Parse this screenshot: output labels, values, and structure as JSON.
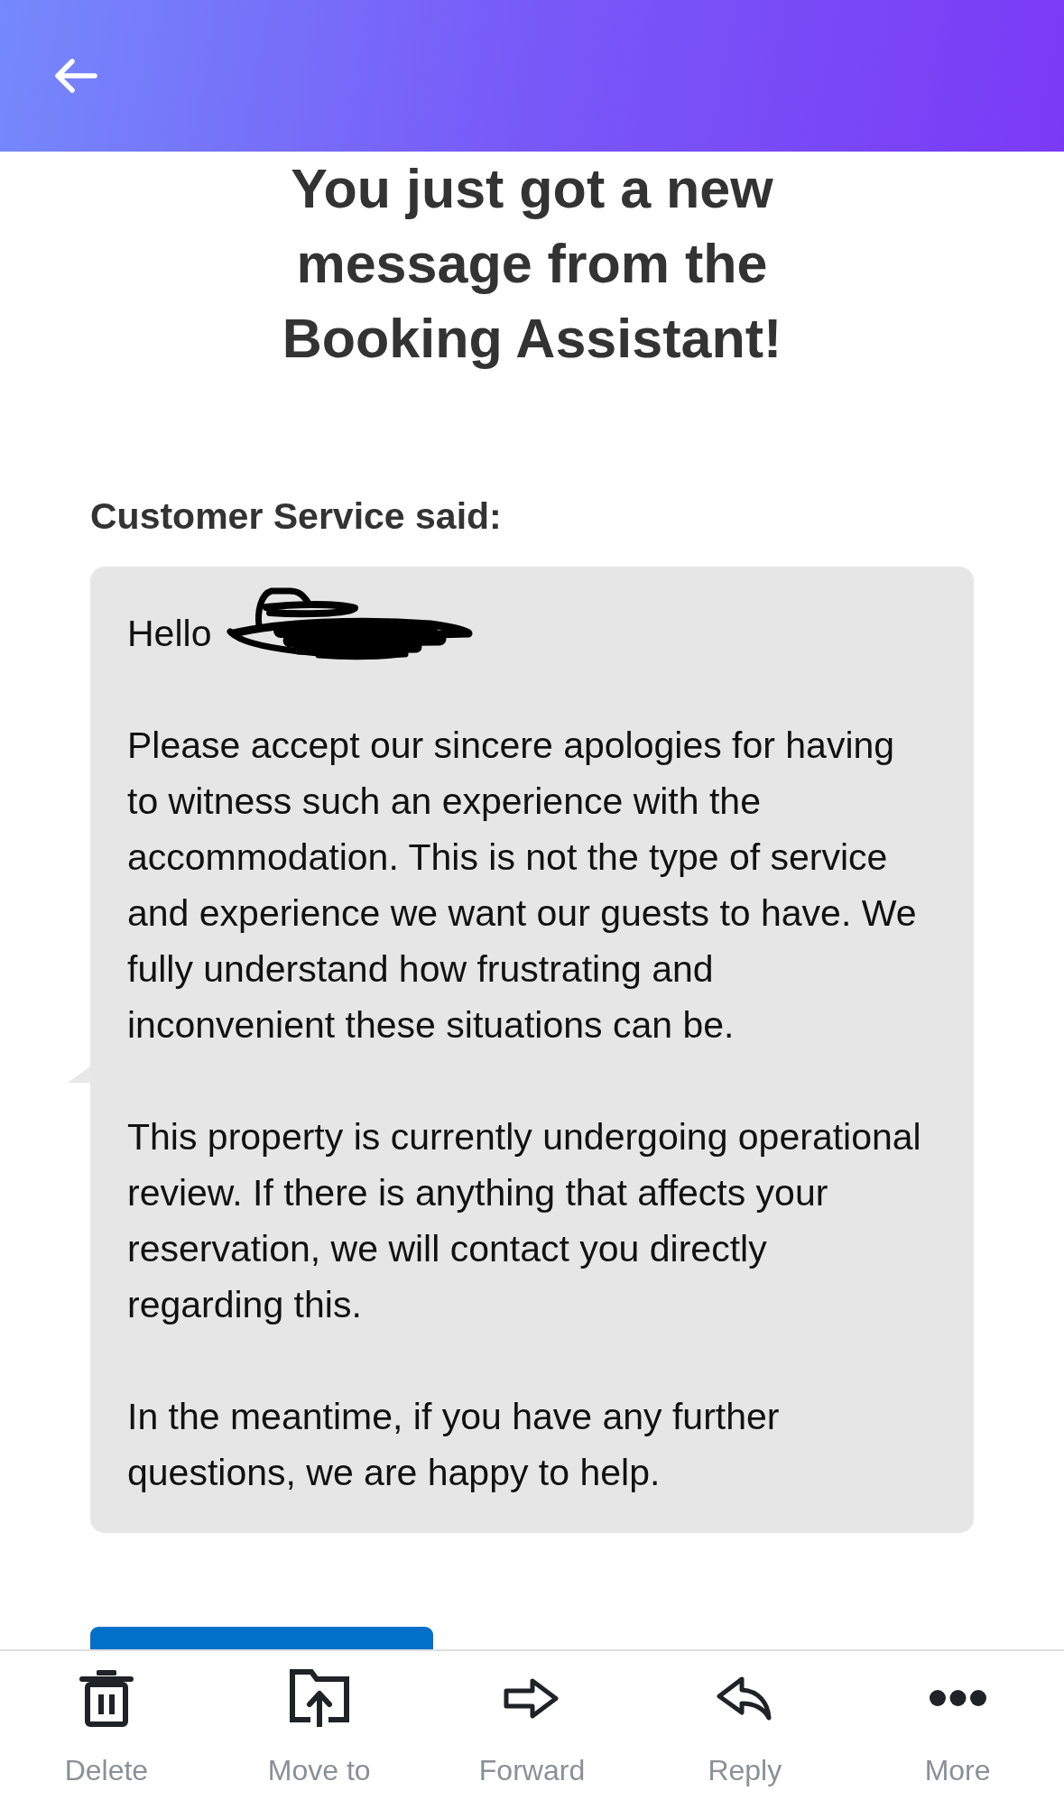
{
  "heading": "You just got a new message from the Booking Assistant!",
  "message": {
    "sender_label": "Customer Service said:",
    "greeting": "Hello",
    "greeting_redacted": true,
    "paragraphs": [
      "Please accept our sincere apologies for having to witness such an experience with the accommodation. This is not the type of service and experience we want our guests to have. We fully understand how frustrating and inconvenient these situations can be.",
      "This property is currently undergoing operational review. If there is anything that affects your reservation, we will contact you directly regarding this.",
      "In the meantime, if you have any further questions, we are happy to help."
    ]
  },
  "toolbar": [
    {
      "kind": "delete",
      "label": "Delete"
    },
    {
      "kind": "move",
      "label": "Move to"
    },
    {
      "kind": "forward",
      "label": "Forward"
    },
    {
      "kind": "reply",
      "label": "Reply"
    },
    {
      "kind": "more",
      "label": "More"
    }
  ]
}
